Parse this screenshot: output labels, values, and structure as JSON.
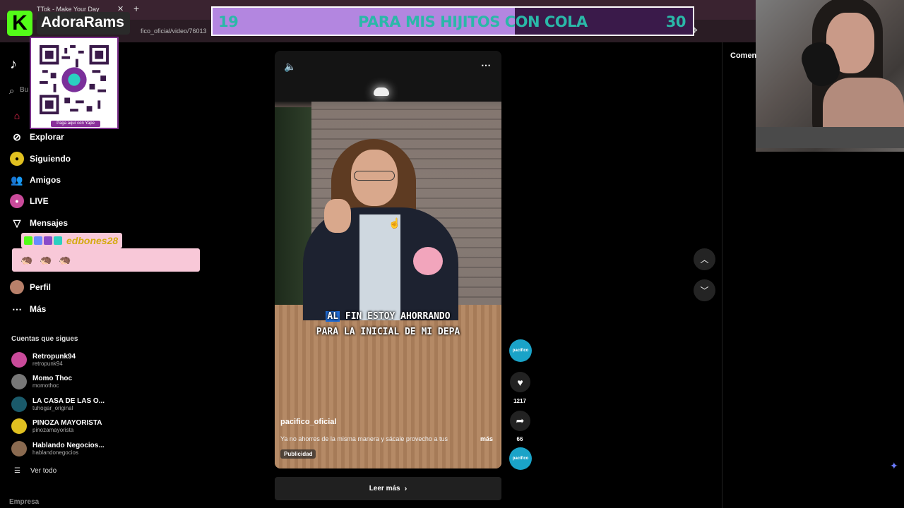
{
  "browser": {
    "tab_title": "TTok - Make Your Day",
    "tab_close": "✕",
    "new_tab": "+",
    "url": "fico_oficial/video/76013"
  },
  "overlay": {
    "brand_logo_letter": "K",
    "brand_name": "AdoraRams",
    "qr_caption": "Paga aquí con Yape",
    "goal": {
      "current": "19",
      "text": "PARA MIS HIJITOS CON COLA",
      "target": "30",
      "progress": 0.63
    },
    "chat": {
      "username": "edbones28",
      "emotes": [
        "🦔",
        "🦔",
        "🦔"
      ]
    }
  },
  "sidebar": {
    "search_placeholder": "Bu",
    "items": [
      {
        "label": "Explorar",
        "icon": "compass-icon"
      },
      {
        "label": "Siguiendo",
        "icon": "following-icon"
      },
      {
        "label": "Amigos",
        "icon": "friends-icon"
      },
      {
        "label": "LIVE",
        "icon": "live-icon"
      },
      {
        "label": "Mensajes",
        "icon": "messages-icon"
      },
      {
        "label": "Perfil",
        "icon": "profile-icon"
      },
      {
        "label": "Más",
        "icon": "more-icon"
      }
    ],
    "following_title": "Cuentas que sigues",
    "accounts": [
      {
        "name": "Retropunk94",
        "handle": "retropunk94",
        "color": "#c94a9a"
      },
      {
        "name": "Momo Thoc",
        "handle": "momothoc",
        "color": "#777777"
      },
      {
        "name": "LA CASA DE LAS O...",
        "handle": "tuhogar_original",
        "color": "#1a5a6a"
      },
      {
        "name": "PINOZA MAYORISTA",
        "handle": "pinozamayorista",
        "color": "#e0c020"
      },
      {
        "name": "Hablando Negocios...",
        "handle": "hablandonegocios",
        "color": "#8a6a50"
      }
    ],
    "see_all": "Ver todo",
    "company": "Empresa"
  },
  "video": {
    "caption_highlight": "AL",
    "caption_line1_rest": " FIN ESTOY AHORRANDO",
    "caption_line2": "PARA LA INICIAL DE MI DEPA",
    "author": "pacifico_oficial",
    "description": "Ya no ahorres de la misma manera y sácale provecho a tus",
    "more": "más",
    "ad_label": "Publicidad",
    "read_more": "Leer más"
  },
  "actions": {
    "avatar_label": "pacifico",
    "likes": "1217",
    "shares": "66"
  },
  "comments_title": "Comen"
}
